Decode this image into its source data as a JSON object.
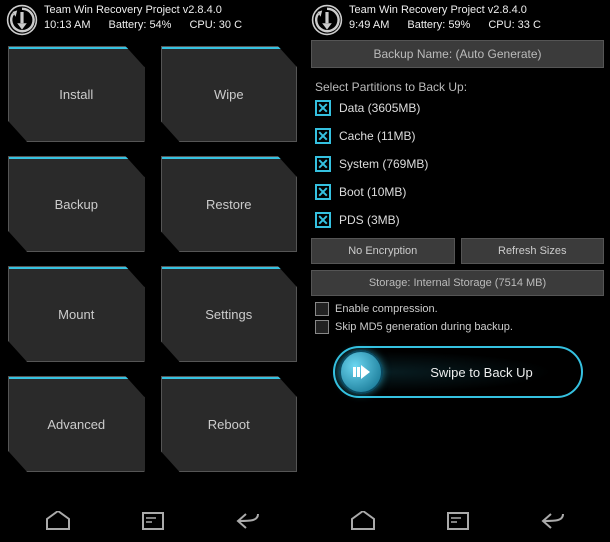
{
  "left": {
    "header": {
      "title": "Team Win Recovery Project  v2.8.4.0",
      "time": "10:13 AM",
      "battery": "Battery: 54%",
      "cpu": "CPU: 30 C"
    },
    "tiles": [
      {
        "label": "Install"
      },
      {
        "label": "Wipe"
      },
      {
        "label": "Backup"
      },
      {
        "label": "Restore"
      },
      {
        "label": "Mount"
      },
      {
        "label": "Settings"
      },
      {
        "label": "Advanced"
      },
      {
        "label": "Reboot"
      }
    ]
  },
  "right": {
    "header": {
      "title": "Team Win Recovery Project  v2.8.4.0",
      "time": "9:49 AM",
      "battery": "Battery: 59%",
      "cpu": "CPU: 33 C"
    },
    "backup_name": "Backup Name: (Auto Generate)",
    "select_label": "Select Partitions to Back Up:",
    "partitions": [
      {
        "label": "Data (3605MB)",
        "checked": true
      },
      {
        "label": "Cache (11MB)",
        "checked": true
      },
      {
        "label": "System (769MB)",
        "checked": true
      },
      {
        "label": "Boot (10MB)",
        "checked": true
      },
      {
        "label": "PDS (3MB)",
        "checked": true
      }
    ],
    "buttons": {
      "no_encryption": "No Encryption",
      "refresh_sizes": "Refresh Sizes"
    },
    "storage": "Storage: Internal Storage (7514 MB)",
    "options": {
      "compression": "Enable compression.",
      "skip_md5": "Skip MD5 generation during backup."
    },
    "swipe_label": "Swipe to Back Up"
  },
  "colors": {
    "accent": "#35c1e0"
  }
}
